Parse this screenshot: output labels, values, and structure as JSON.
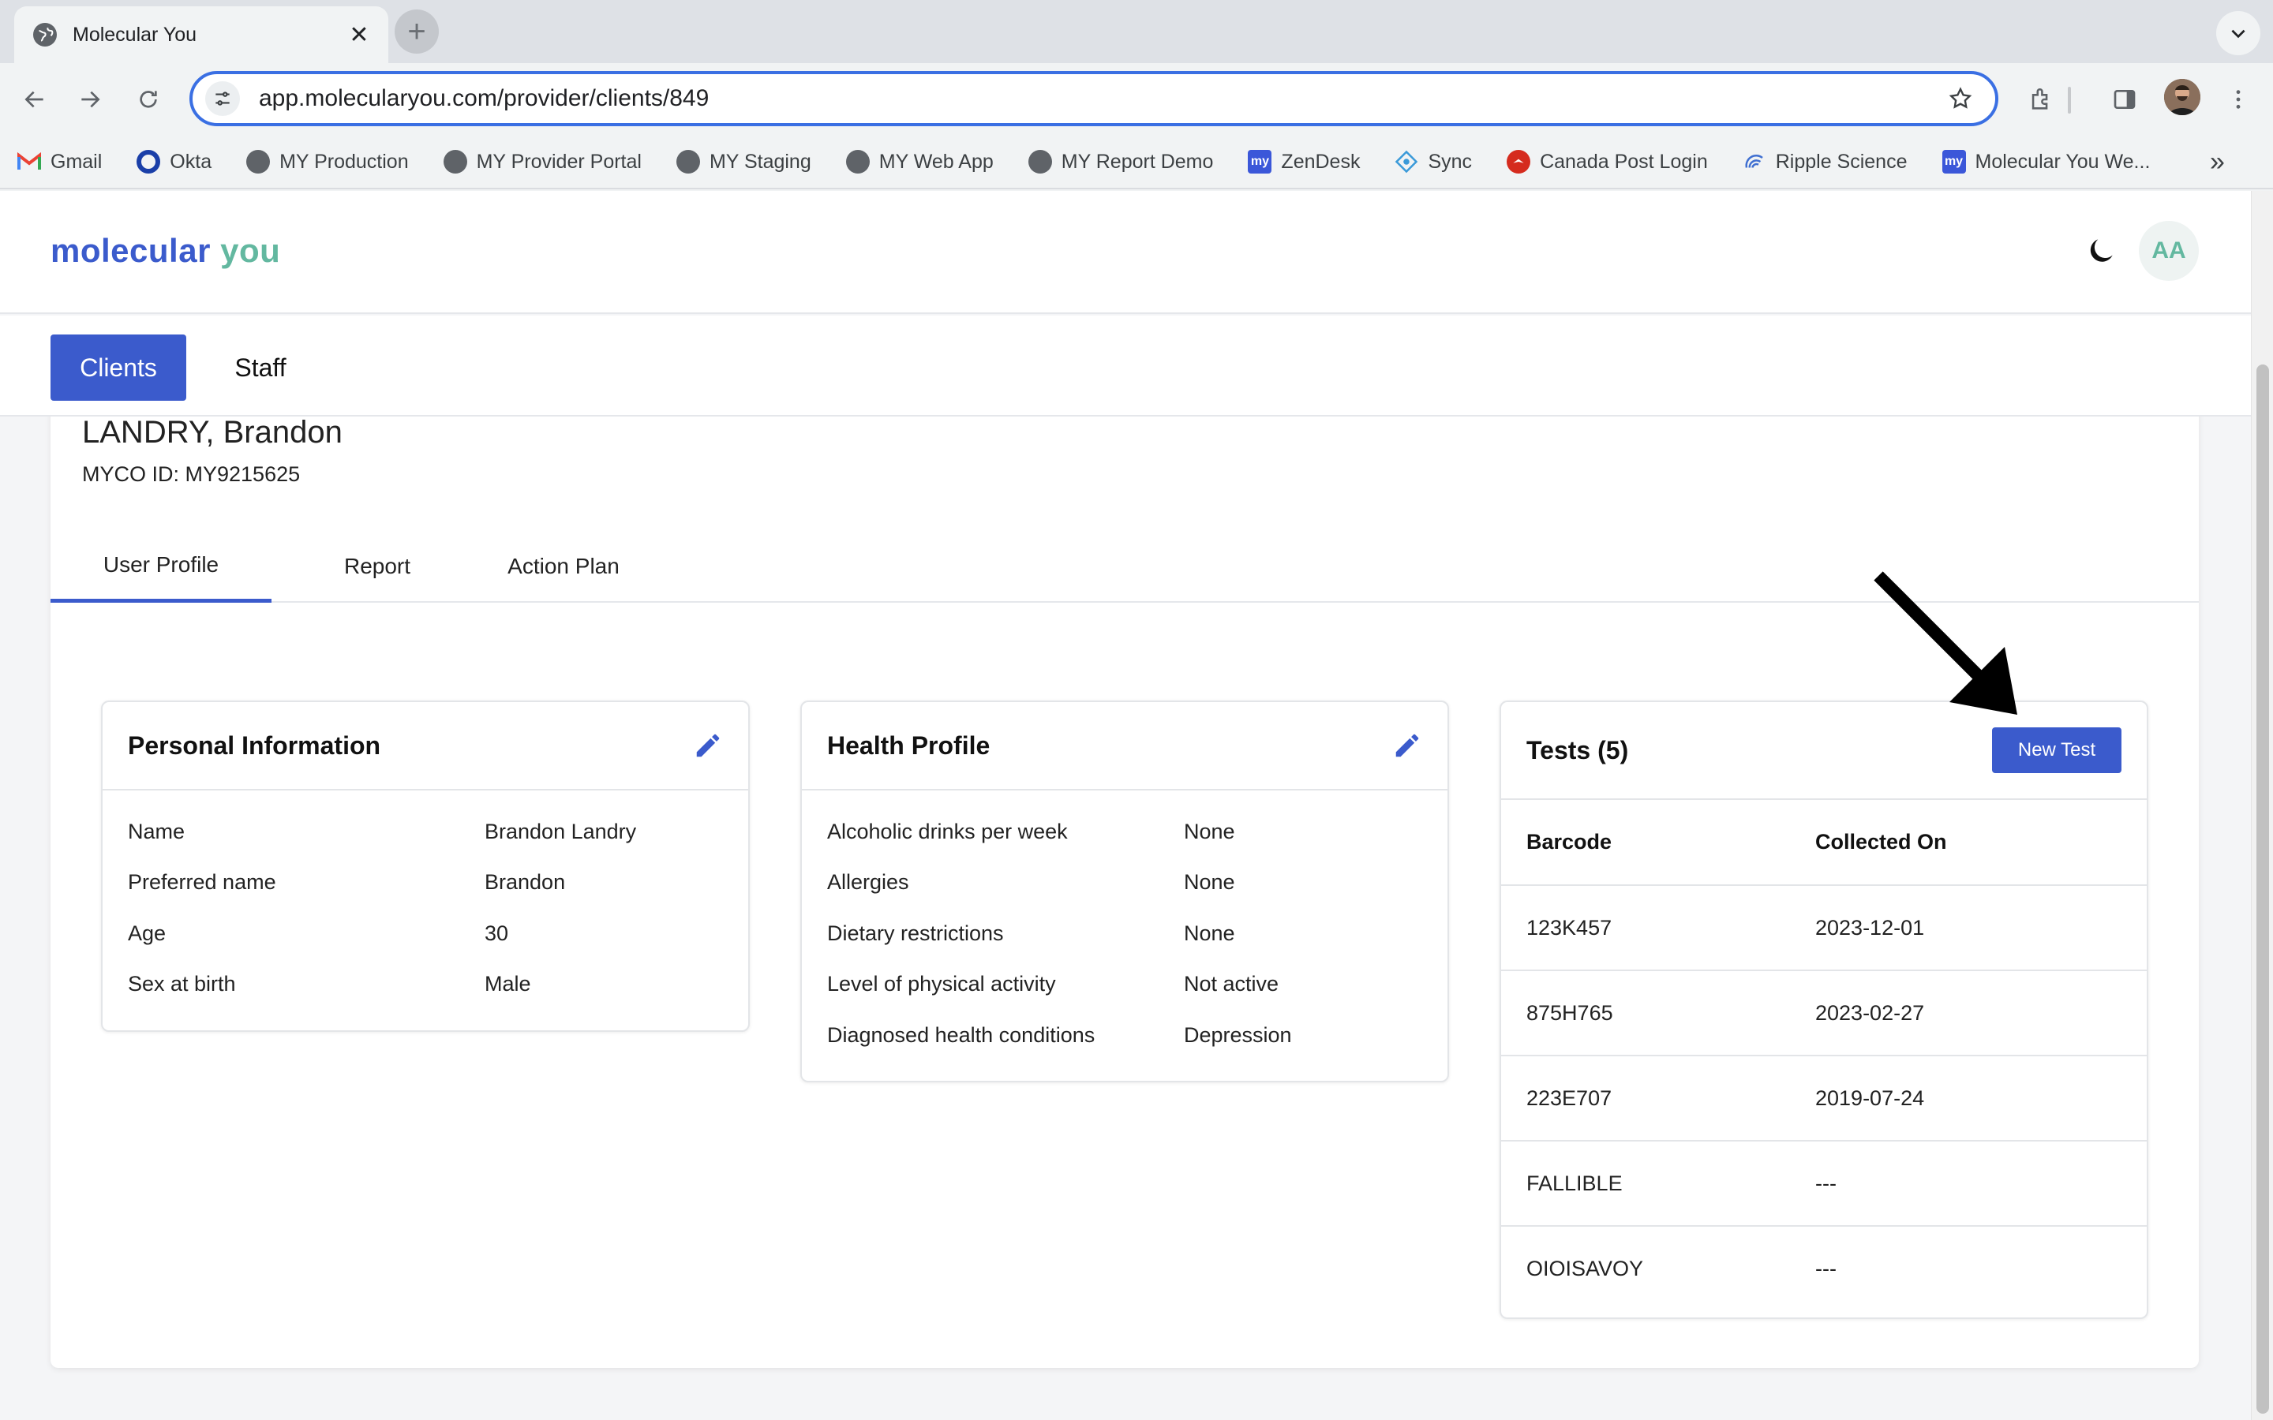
{
  "browser": {
    "tab_title": "Molecular You",
    "url": "app.molecularyou.com/provider/clients/849",
    "bookmarks": [
      {
        "label": "Gmail",
        "icon": "gmail-icon"
      },
      {
        "label": "Okta",
        "icon": "okta-icon"
      },
      {
        "label": "MY Production",
        "icon": "globe-icon"
      },
      {
        "label": "MY Provider Portal",
        "icon": "globe-icon"
      },
      {
        "label": "MY Staging",
        "icon": "globe-icon"
      },
      {
        "label": "MY Web App",
        "icon": "globe-icon"
      },
      {
        "label": "MY Report Demo",
        "icon": "globe-icon"
      },
      {
        "label": "ZenDesk",
        "icon": "my-square-icon"
      },
      {
        "label": "Sync",
        "icon": "sync-icon"
      },
      {
        "label": "Canada Post Login",
        "icon": "canada-post-icon"
      },
      {
        "label": "Ripple Science",
        "icon": "ripple-icon"
      },
      {
        "label": "Molecular You We...",
        "icon": "my-square-icon"
      }
    ]
  },
  "app": {
    "logo_part1": "molecular",
    "logo_part2": "you",
    "user_initials": "AA",
    "nav": {
      "clients": "Clients",
      "staff": "Staff"
    }
  },
  "client": {
    "name": "LANDRY, Brandon",
    "myco_id": "MYCO ID: MY9215625"
  },
  "tabs": [
    {
      "label": "User Profile",
      "active": true
    },
    {
      "label": "Report",
      "active": false
    },
    {
      "label": "Action Plan",
      "active": false
    }
  ],
  "personal_info": {
    "title": "Personal Information",
    "rows": [
      {
        "k": "Name",
        "v": "Brandon Landry"
      },
      {
        "k": "Preferred name",
        "v": "Brandon"
      },
      {
        "k": "Age",
        "v": "30"
      },
      {
        "k": "Sex at birth",
        "v": "Male"
      }
    ]
  },
  "health_profile": {
    "title": "Health Profile",
    "rows": [
      {
        "k": "Alcoholic drinks per week",
        "v": "None"
      },
      {
        "k": "Allergies",
        "v": "None"
      },
      {
        "k": "Dietary restrictions",
        "v": "None"
      },
      {
        "k": "Level of physical activity",
        "v": "Not active"
      },
      {
        "k": "Diagnosed health conditions",
        "v": "Depression"
      }
    ]
  },
  "tests": {
    "title": "Tests (5)",
    "new_button": "New Test",
    "columns": [
      "Barcode",
      "Collected On"
    ],
    "rows": [
      {
        "barcode": "123K457",
        "collected": "2023-12-01"
      },
      {
        "barcode": "875H765",
        "collected": "2023-02-27"
      },
      {
        "barcode": "223E707",
        "collected": "2019-07-24"
      },
      {
        "barcode": "FALLIBLE",
        "collected": "---"
      },
      {
        "barcode": "OIOISAVOY",
        "collected": "---"
      }
    ]
  },
  "colors": {
    "accent": "#3b5bcc",
    "brand_green": "#63b8a0"
  }
}
